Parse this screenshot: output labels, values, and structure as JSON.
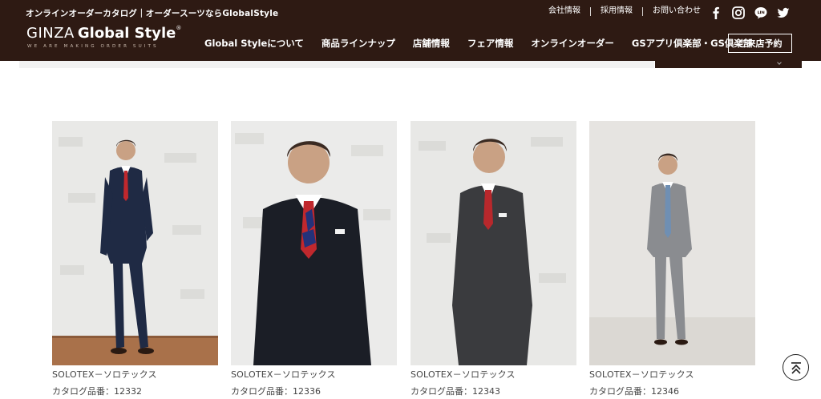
{
  "header": {
    "tagline": "オンラインオーダーカタログ｜オーダースーツならGlobalStyle",
    "logo_main": "GINZA",
    "logo_brand": "Global Style",
    "logo_reg": "®",
    "logo_sub": "WE ARE MAKING ORDER SUITS",
    "util_links": [
      "会社情報",
      "採用情報",
      "お問い合わせ"
    ],
    "social_icons": [
      "facebook-icon",
      "instagram-icon",
      "line-icon",
      "twitter-icon"
    ],
    "nav": [
      "Global Styleについて",
      "商品ラインナップ",
      "店舗情報",
      "フェア情報",
      "オンラインオーダー",
      "GSアプリ倶楽部・GS倶楽部"
    ],
    "reserve_label": "ご来店予約",
    "brand_color": "#2e1a13"
  },
  "products": [
    {
      "name": "SOLOTEX－ソロテックス",
      "code": "カタログ品番：12332",
      "suit_color": "#1f2a44",
      "tie_color": "#c0282d"
    },
    {
      "name": "SOLOTEX－ソロテックス",
      "code": "カタログ品番：12336",
      "suit_color": "#1b1e26",
      "tie_color": "#c0282d"
    },
    {
      "name": "SOLOTEX－ソロテックス",
      "code": "カタログ品番：12343",
      "suit_color": "#3a3b3e",
      "tie_color": "#b8282c"
    },
    {
      "name": "SOLOTEX－ソロテックス",
      "code": "カタログ品番：12346",
      "suit_color": "#8a8c90",
      "tie_color": "#6f8fb3"
    }
  ],
  "back_to_top_icon": "double-chevron-up-icon"
}
